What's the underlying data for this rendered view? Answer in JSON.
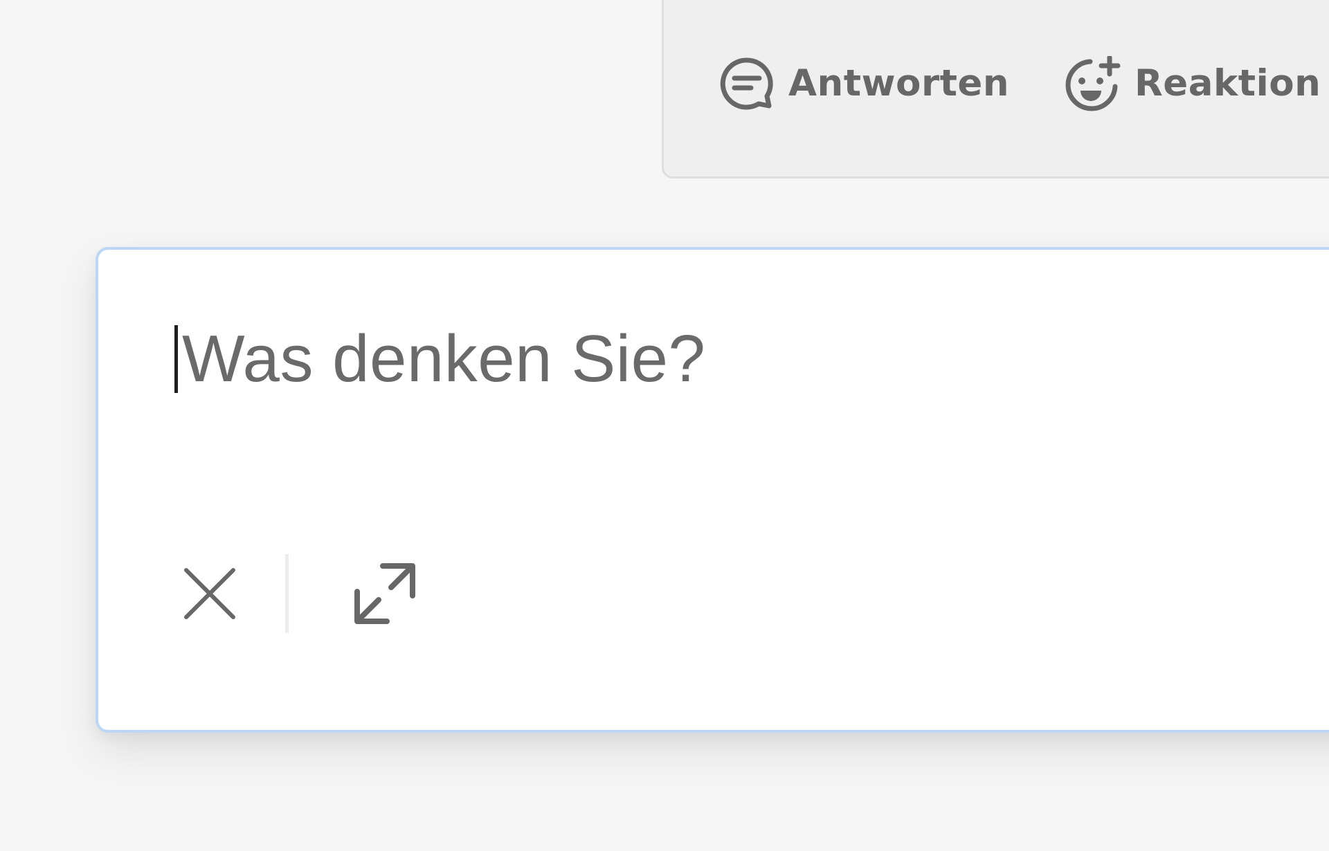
{
  "message": {
    "actions": [
      {
        "label": "Antworten",
        "icon": "chat-bubble-icon"
      },
      {
        "label": "Reaktion",
        "icon": "add-reaction-icon"
      }
    ]
  },
  "composer": {
    "placeholder": "Was denken Sie?",
    "toolbar": {
      "close_icon": "close-icon",
      "expand_icon": "expand-icon"
    }
  },
  "colors": {
    "background": "#f6f6f6",
    "card": "#efefef",
    "composer_border": "#bcd7f6",
    "text_muted": "#676767"
  }
}
